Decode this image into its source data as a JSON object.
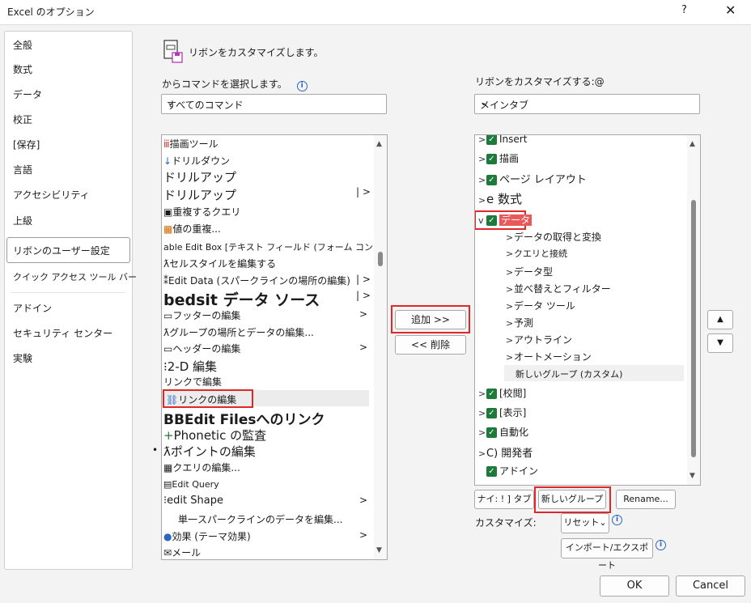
{
  "window": {
    "title": "Excel のオプション",
    "help": "?",
    "close": "✕"
  },
  "nav": {
    "items": [
      "全般",
      "数式",
      "データ",
      "校正",
      "[保存]",
      "言語",
      "アクセシビリティ",
      "上級",
      "リボンのユーザー設定",
      "クイック アクセス ツール バー",
      "アドイン",
      "セキュリティ センター",
      "実験"
    ],
    "selected_index": 8
  },
  "header": {
    "title": "リボンをカスタマイズします。"
  },
  "left": {
    "label": "からコマンドを選択します。",
    "info": "i",
    "combo_value": "すべてのコマンド",
    "commands": [
      "描画ツール",
      "ドリルダウン",
      "ドリルアップ",
      "ドリルアップ",
      "重複するクエリ",
      "値の重複...",
      "able Edit Box [テキスト フィールド (フォーム コントロール))",
      "セルスタイルを編集する",
      "Edit Data (スパークラインの場所の編集)",
      "bedsit データ ソース",
      "フッターの編集",
      "グループの場所とデータの編集...",
      "ヘッダーの編集",
      "2-D 編集",
      "リンクで編集",
      "リンクの編集",
      "BBEdit Filesへのリンク",
      "Phonetic の監査",
      "ポイントの編集",
      "クエリの編集...",
      "Edit Query",
      "edit Shape",
      "単一スパークラインのデータを編集...",
      "効果 (テーマ効果)",
      "メール"
    ]
  },
  "center": {
    "add": "追加 >>",
    "remove": "<< 削除"
  },
  "right": {
    "label": "リボンをカスタマイズする:@",
    "combo_value": "メインタブ",
    "tree": [
      "Insert",
      "描画",
      "ページ レイアウト",
      "e 数式",
      "データ",
      "データの取得と変換",
      "クエリと接続",
      "データ型",
      "並べ替えとフィルター",
      "データ ツール",
      "予測",
      "アウトライン",
      "オートメーション",
      "新しいグループ (カスタム)",
      "[校閲]",
      "[表示]",
      "自動化",
      "C) 開発者",
      "アドイン"
    ],
    "new_tab": "ナイ: ! ] タブ",
    "new_group": "新しいグループ",
    "rename": "Rename...",
    "customize_label": "カスタマイズ:",
    "reset": "リセット",
    "reset_chevron": "⌄",
    "import_export": "インポート/エクスポート",
    "move_up": "▲",
    "move_down": "▼"
  },
  "footer": {
    "ok": "OK",
    "cancel": "Cancel"
  },
  "colors": {
    "check": "#1e7a3a",
    "highlight": "#e02828",
    "accent": "#2b66c2"
  }
}
